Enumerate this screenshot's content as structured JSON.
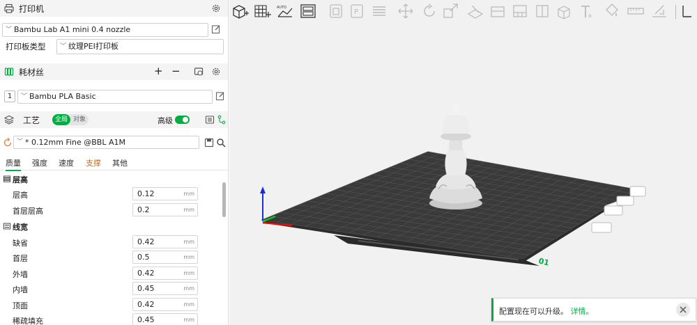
{
  "printer": {
    "section_title": "打印机",
    "printer_name": "Bambu Lab A1 mini 0.4 nozzle",
    "plate_label": "打印板类型",
    "plate_value": "纹理PEI打印板"
  },
  "filament": {
    "section_title": "耗材丝",
    "slot_number": "1",
    "name": "Bambu PLA Basic",
    "add_symbol": "+",
    "remove_symbol": "−"
  },
  "process": {
    "section_title": "工艺",
    "scope_global": "全局",
    "scope_object": "对象",
    "advanced_label": "高级",
    "advanced_on": true,
    "preset": "* 0.12mm Fine @BBL A1M",
    "tabs": [
      "质量",
      "强度",
      "速度",
      "支撑",
      "其他"
    ],
    "active_tab": "质量"
  },
  "settings": {
    "groups": [
      {
        "title": "层高",
        "icon": "layers-icon",
        "rows": [
          {
            "label": "层高",
            "value": "0.12",
            "unit": "mm"
          },
          {
            "label": "首层层高",
            "value": "0.2",
            "unit": "mm"
          }
        ]
      },
      {
        "title": "线宽",
        "icon": "line-width-icon",
        "rows": [
          {
            "label": "缺省",
            "value": "0.42",
            "unit": "mm"
          },
          {
            "label": "首层",
            "value": "0.5",
            "unit": "mm"
          },
          {
            "label": "外墙",
            "value": "0.42",
            "unit": "mm"
          },
          {
            "label": "内墙",
            "value": "0.45",
            "unit": "mm"
          },
          {
            "label": "顶面",
            "value": "0.42",
            "unit": "mm"
          },
          {
            "label": "稀疏填充",
            "value": "0.45",
            "unit": "mm"
          }
        ]
      }
    ]
  },
  "toolbar_icons": [
    "add-cube-icon",
    "grid-plus-icon",
    "auto-arrange-icon",
    "plate-layout-icon",
    "orient-icon",
    "plate-icon",
    "layers-list-icon",
    "move-icon",
    "rotate-icon",
    "scale-icon",
    "cut-icon",
    "lay-on-face-icon",
    "support-paint-icon",
    "seam-icon",
    "text-icon",
    "color-paint-icon",
    "measure-icon",
    "assembly-icon"
  ],
  "plate": {
    "number": "01"
  },
  "notification": {
    "message": "配置现在可以升级。",
    "link": "详情。"
  },
  "colors": {
    "accent": "#00ae42",
    "support_tab": "#c96a16",
    "plate_dark": "#3a3a3a",
    "background": "#f1f1f1"
  }
}
